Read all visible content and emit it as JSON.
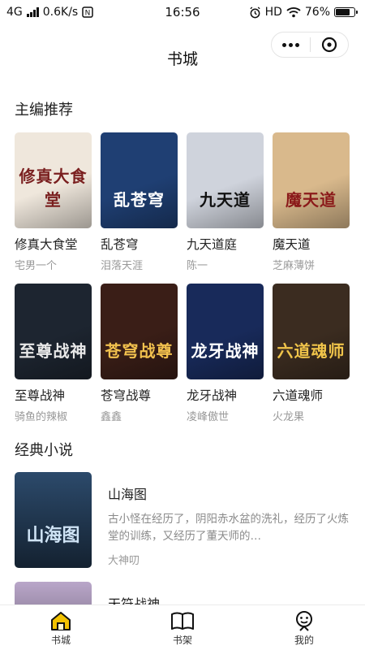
{
  "status_bar": {
    "network": "4G",
    "speed": "0.6K/s",
    "time": "16:56",
    "hd_label": "HD",
    "battery_text": "76%",
    "battery_level": 0.76
  },
  "header": {
    "title": "书城",
    "more_icon": "more-dots-icon",
    "close_icon": "close-circle-icon"
  },
  "sections": {
    "featured_title": "主编推荐",
    "classic_title": "经典小说"
  },
  "featured_books": [
    {
      "title": "修真大食堂",
      "author": "宅男一个",
      "cover_text": "修真大食堂",
      "bg": "#efe7dc",
      "fg": "#7a1f1f"
    },
    {
      "title": "乱苍穹",
      "author": "泪落天涯",
      "cover_text": "乱苍穹",
      "bg": "#1f3f73",
      "fg": "#ffffff"
    },
    {
      "title": "九天道庭",
      "author": "陈一",
      "cover_text": "九天道",
      "bg": "#cfd3dc",
      "fg": "#111111"
    },
    {
      "title": "魔天道",
      "author": "芝麻薄饼",
      "cover_text": "魔天道",
      "bg": "#d9b98c",
      "fg": "#8b1a1a"
    },
    {
      "title": "至尊战神",
      "author": "骑鱼的辣椒",
      "cover_text": "至尊战神",
      "bg": "#1d2530",
      "fg": "#e8e8e8"
    },
    {
      "title": "苍穹战尊",
      "author": "鑫鑫",
      "cover_text": "苍穹战尊",
      "bg": "#3a1e17",
      "fg": "#f2c14e"
    },
    {
      "title": "龙牙战神",
      "author": "凌峰傲世",
      "cover_text": "龙牙战神",
      "bg": "#182a5a",
      "fg": "#ffffff"
    },
    {
      "title": "六道魂师",
      "author": "火龙果",
      "cover_text": "六道魂师",
      "bg": "#3b2c20",
      "fg": "#f0c44a"
    }
  ],
  "classic_books": [
    {
      "title": "山海图",
      "description": "古小怪在经历了，阴阳赤水盆的洗礼，经历了火炼堂的训练，又经历了董天师的…",
      "author": "大神叨",
      "cover_text": "山海图",
      "bg": "#2c4a6b",
      "fg": "#cfe3f5"
    },
    {
      "title": "天符战神",
      "description": "",
      "author": "",
      "cover_text": "",
      "bg": "#b9a6c9",
      "fg": "#ffffff"
    }
  ],
  "tab_bar": {
    "tabs": [
      {
        "label": "书城",
        "icon": "home-icon",
        "active": true
      },
      {
        "label": "书架",
        "icon": "open-book-icon",
        "active": false
      },
      {
        "label": "我的",
        "icon": "profile-icon",
        "active": false
      }
    ],
    "active_color": "#f2c200"
  }
}
